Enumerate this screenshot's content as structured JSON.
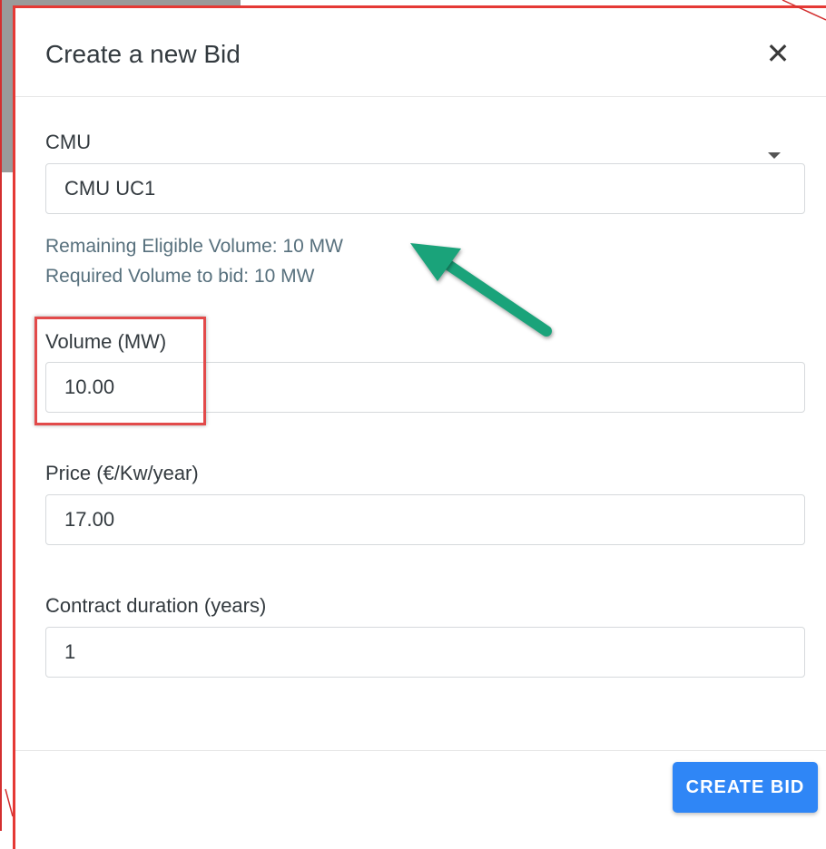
{
  "modal": {
    "title": "Create a new Bid",
    "close_icon": "close-icon"
  },
  "fields": {
    "cmu": {
      "label": "CMU",
      "value": "CMU UC1",
      "icon": "chevron-down-icon"
    },
    "volume": {
      "label": "Volume (MW)",
      "value": "10.00"
    },
    "price": {
      "label": "Price (€/Kw/year)",
      "value": "17.00"
    },
    "duration": {
      "label": "Contract duration (years)",
      "value": "1"
    }
  },
  "info": {
    "remaining": "Remaining Eligible Volume: 10 MW",
    "required": "Required Volume to bid: 10 MW"
  },
  "footer": {
    "create_label": "CREATE BID"
  },
  "colors": {
    "accent": "#2f86f6",
    "annotation_red": "#e53935",
    "annotation_arrow": "#1aa37a",
    "info_text": "#57707d"
  }
}
